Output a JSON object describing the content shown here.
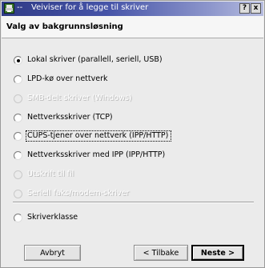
{
  "window": {
    "title": "Veiviser for å legge til skriver",
    "title_prefix": "--",
    "help_label": "?",
    "close_label": "x"
  },
  "header": {
    "title": "Valg av bakgrunnsløsning"
  },
  "options": [
    {
      "label": "Lokal skriver (parallell, seriell, USB)",
      "selected": true,
      "enabled": true
    },
    {
      "label": "LPD-kø over nettverk",
      "selected": false,
      "enabled": true
    },
    {
      "label": "SMB-delt skriver (Windows)",
      "selected": false,
      "enabled": false
    },
    {
      "label": "Nettverksskriver (TCP)",
      "selected": false,
      "enabled": true
    },
    {
      "label": "CUPS-tjener over nettverk (IPP/HTTP)",
      "selected": false,
      "enabled": true,
      "focused": true
    },
    {
      "label": "Nettverksskriver med IPP (IPP/HTTP)",
      "selected": false,
      "enabled": true
    },
    {
      "label": "Utskrift til fil",
      "selected": false,
      "enabled": false
    },
    {
      "label": "Seriell faks/modem-skriver",
      "selected": false,
      "enabled": false
    },
    {
      "label": "Skriverklasse",
      "selected": false,
      "enabled": true
    }
  ],
  "buttons": {
    "cancel": "Avbryt",
    "back": "< Tilbake",
    "next": "Neste >"
  },
  "colors": {
    "titlebar_start": "#2f3b86",
    "titlebar_end": "#b7bde0",
    "window_bg": "#ebebeb"
  }
}
